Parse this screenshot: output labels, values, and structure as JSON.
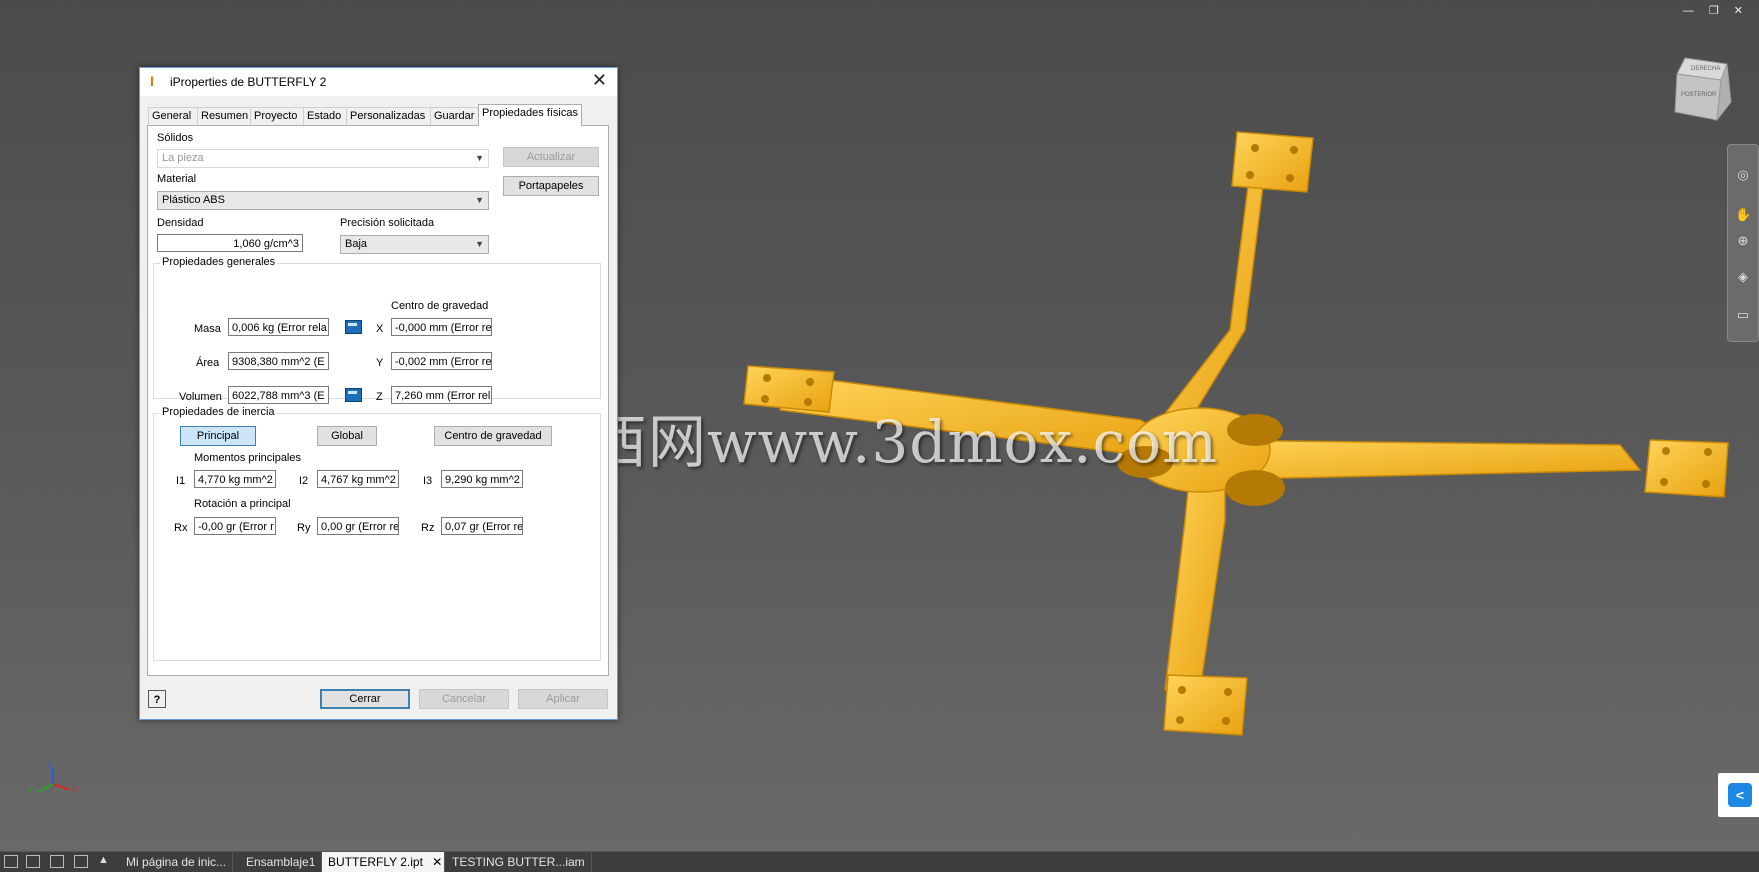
{
  "window_controls": {
    "minimize": "—",
    "restore": "❐",
    "close": "✕"
  },
  "dialog": {
    "title": "iProperties de BUTTERFLY 2",
    "tabs": [
      "General",
      "Resumen",
      "Proyecto",
      "Estado",
      "Personalizadas",
      "Guardar",
      "Propiedades físicas"
    ],
    "active_tab": "Propiedades físicas",
    "solids_label": "Sólidos",
    "solids_value": "La pieza",
    "update_button": "Actualizar",
    "clipboard_button": "Portapapeles",
    "material_label": "Material",
    "material_value": "Plástico ABS",
    "density_label": "Densidad",
    "density_value": "1,060 g/cm^3",
    "precision_label": "Precisión solicitada",
    "precision_value": "Baja",
    "general_group": {
      "title": "Propiedades generales",
      "mass_label": "Masa",
      "mass_value": "0,006 kg (Error rela",
      "area_label": "Área",
      "area_value": "9308,380 mm^2 (E",
      "volume_label": "Volumen",
      "volume_value": "6022,788 mm^3 (E",
      "cog_label": "Centro de gravedad",
      "x_label": "X",
      "x_value": "-0,000 mm (Error re",
      "y_label": "Y",
      "y_value": "-0,002 mm (Error re",
      "z_label": "Z",
      "z_value": "7,260 mm (Error rel"
    },
    "inertia_group": {
      "title": "Propiedades de inercia",
      "principal_button": "Principal",
      "global_button": "Global",
      "cog_button": "Centro de gravedad",
      "moments_label": "Momentos principales",
      "i1_label": "I1",
      "i1_value": "4,770 kg mm^2",
      "i2_label": "I2",
      "i2_value": "4,767 kg mm^2",
      "i3_label": "I3",
      "i3_value": "9,290 kg mm^2",
      "rotation_label": "Rotación a principal",
      "rx_label": "Rx",
      "rx_value": "-0,00 gr (Error r",
      "ry_label": "Ry",
      "ry_value": "0,00 gr (Error re",
      "rz_label": "Rz",
      "rz_value": "0,07 gr (Error re"
    },
    "help_icon": "?",
    "close_button": "Cerrar",
    "cancel_button": "Cancelar",
    "apply_button": "Aplicar"
  },
  "viewcube": {
    "top_label": "DERECHA",
    "side_label": "POSTERIOR"
  },
  "watermark": "莫西网www.3dmox.com",
  "model_color": "#f5b81e",
  "share_icon": "<",
  "bottom_tabs": [
    "Mi página de inic...",
    "Ensamblaje1",
    "BUTTERFLY 2.ipt",
    "TESTING BUTTER...iam"
  ],
  "active_bottom_tab": "BUTTERFLY 2.ipt",
  "bottom_tab_close": "✕"
}
